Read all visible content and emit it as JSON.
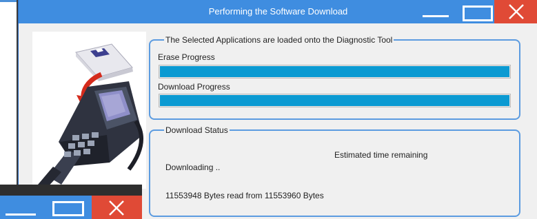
{
  "window": {
    "title": "Performing the Software Download",
    "controls": [
      "minimize-icon",
      "maximize-icon",
      "close-icon"
    ]
  },
  "apps_group": {
    "legend": "The Selected Applications are loaded onto the Diagnostic Tool",
    "erase_label": "Erase Progress",
    "erase_progress": 1.0,
    "download_label": "Download Progress",
    "download_progress": 1.0
  },
  "status_group": {
    "legend": "Download Status",
    "estimated_time_label": "Estimated time remaining",
    "downloading_text": "Downloading ..",
    "bytes_text": "11553948 Bytes read from 11553960 Bytes"
  },
  "colors": {
    "titlebar": "#3f8de0",
    "close_button": "#e04a36",
    "progress_fill": "#0b9ad2",
    "group_border": "#5b9be0"
  },
  "taskbar_overlay": {
    "controls": [
      "minimize-icon",
      "maximize-icon",
      "close-icon"
    ]
  }
}
